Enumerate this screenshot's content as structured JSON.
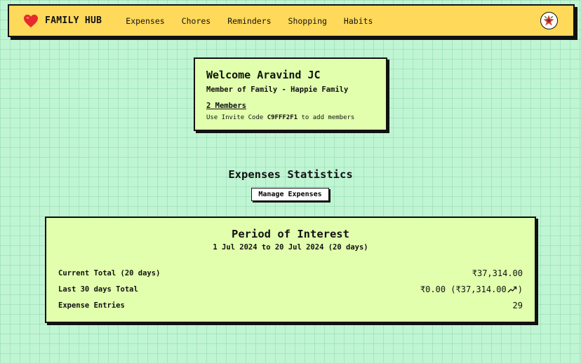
{
  "nav": {
    "brand": "FAMILY HUB",
    "items": [
      "Expenses",
      "Chores",
      "Reminders",
      "Shopping",
      "Habits"
    ]
  },
  "welcome": {
    "title": "Welcome Aravind JC",
    "family_line": "Member of Family - Happie Family",
    "members": "2 Members",
    "invite_prefix": "Use Invite Code ",
    "invite_code": "C9FFF2F1",
    "invite_suffix": " to add members"
  },
  "stats": {
    "title": "Expenses Statistics",
    "manage_label": "Manage Expenses"
  },
  "period": {
    "title": "Period of Interest",
    "range": "1 Jul 2024 to 20 Jul 2024 (20 days)",
    "rows": [
      {
        "label": "Current Total (20 days)",
        "value": "₹37,314.00"
      },
      {
        "label": "Last 30 days Total",
        "value": "₹0.00 (₹37,314.00",
        "value_suffix": ")",
        "trend": "trend-up-icon"
      },
      {
        "label": "Expense Entries",
        "value": "29"
      }
    ]
  },
  "colors": {
    "background": "#c0f5d3",
    "navbar": "#ffd95a",
    "card": "#e1ffad",
    "heart": "#e52b2b"
  }
}
